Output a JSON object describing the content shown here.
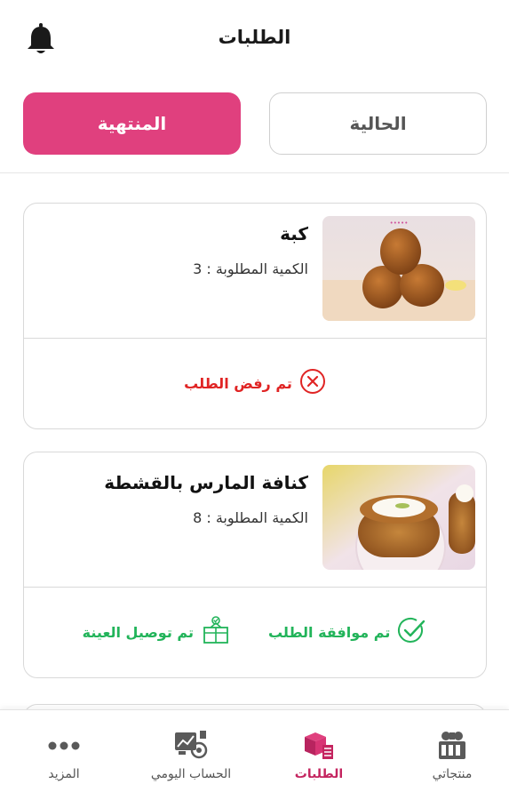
{
  "header": {
    "title": "الطلبات",
    "notification_icon": "bell-icon"
  },
  "tabs": {
    "finished_label": "المنتهية",
    "current_label": "الحالية",
    "active": "finished"
  },
  "orders": [
    {
      "name": "كبة",
      "quantity_text": "الكمية المطلوبة : 3",
      "statuses": [
        {
          "text": "تم رفض الطلب",
          "type": "rejected",
          "icon": "x-circle-icon"
        }
      ]
    },
    {
      "name": "كنافة المارس بالقشطة",
      "quantity_text": "الكمية المطلوبة : 8",
      "statuses": [
        {
          "text": "تم موافقة الطلب",
          "type": "approved",
          "icon": "check-circle-icon"
        },
        {
          "text": "تم توصيل العينة",
          "type": "delivered",
          "icon": "delivery-box-icon"
        }
      ]
    }
  ],
  "bottom_nav": {
    "products": "منتجاتي",
    "orders": "الطلبات",
    "daily_account": "الحساب اليومي",
    "more": "المزيد",
    "active": "orders"
  },
  "colors": {
    "accent": "#e0407e",
    "rejected": "#e02424",
    "success": "#22b45a"
  }
}
